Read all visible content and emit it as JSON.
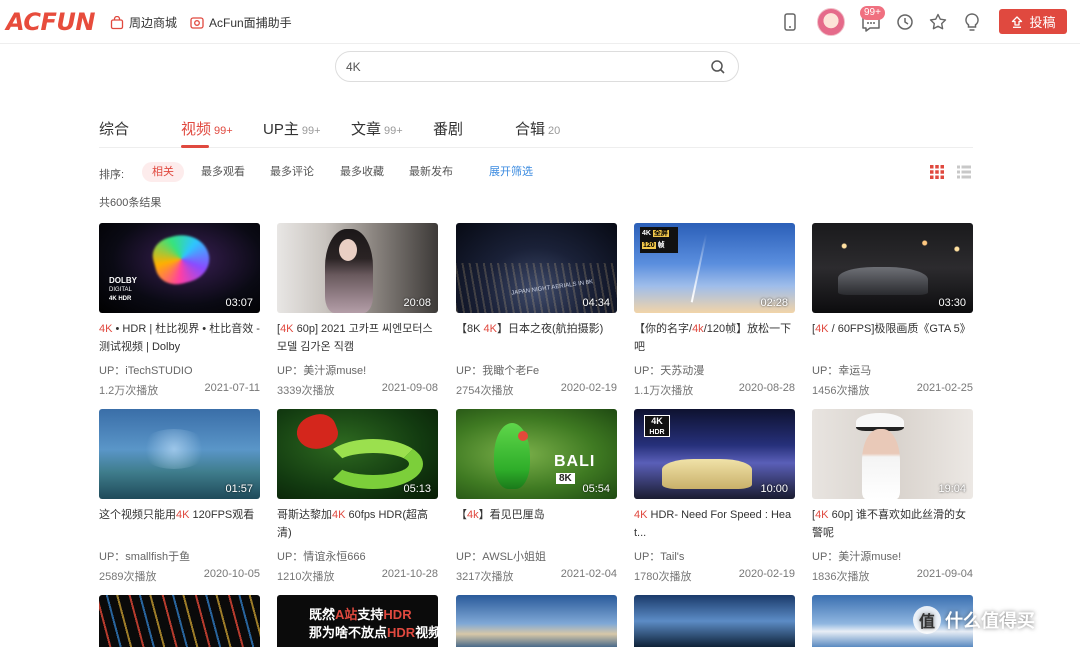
{
  "header": {
    "logo_text": "ACFUN",
    "links": [
      {
        "label": "周边商城",
        "icon": "shop-icon"
      },
      {
        "label": "AcFun面捕助手",
        "icon": "camera-icon"
      }
    ],
    "badge": "99+",
    "upload_label": "投稿"
  },
  "search": {
    "value": "4K"
  },
  "tabs": [
    {
      "label": "综合",
      "count": ""
    },
    {
      "label": "视频",
      "count": "99+"
    },
    {
      "label": "UP主",
      "count": "99+"
    },
    {
      "label": "文章",
      "count": "99+"
    },
    {
      "label": "番剧",
      "count": ""
    },
    {
      "label": "合辑",
      "count": "20"
    }
  ],
  "sort": {
    "label": "排序:",
    "options": [
      "相关",
      "最多观看",
      "最多评论",
      "最多收藏",
      "最新发布"
    ],
    "expand": "展开筛选"
  },
  "result_count": "共600条结果",
  "videos": [
    {
      "hl": "4K",
      "title": " • HDR | 杜比视界 • 杜比音效 - 测试视频 | Dolby",
      "duration": "03:07",
      "up": "UP：iTechSTUDIO",
      "views": "1.2万次播放",
      "date": "2021-07-11"
    },
    {
      "pre": "[",
      "hl": "4K",
      "title": " 60p] 2021 고카프 씨엔모터스 모델 김가온 직캠",
      "duration": "20:08",
      "up": "UP：美汁源muse!",
      "views": "3339次播放",
      "date": "2021-09-08"
    },
    {
      "pre": "【8K ",
      "hl": "4K",
      "title": "】日本之夜(航拍摄影)",
      "duration": "04:34",
      "up": "UP：我瞰个老Fe",
      "views": "2754次播放",
      "date": "2020-02-19"
    },
    {
      "pre": "【你的名字/",
      "hl": "4k",
      "title": "/120帧】放松一下吧",
      "duration": "02:28",
      "up": "UP：天苏动漫",
      "views": "1.1万次播放",
      "date": "2020-08-28"
    },
    {
      "pre": "[",
      "hl": "4K",
      "title": " / 60FPS]极限画质《GTA 5》",
      "duration": "03:30",
      "up": "UP：幸运马",
      "views": "1456次播放",
      "date": "2021-02-25"
    },
    {
      "pre": "这个视频只能用",
      "hl": "4K",
      "title": " 120FPS观看",
      "duration": "01:57",
      "up": "UP：smallfish于鱼",
      "views": "2589次播放",
      "date": "2020-10-05"
    },
    {
      "pre": "哥斯达黎加",
      "hl": "4K",
      "title": " 60fps HDR(超高清)",
      "duration": "05:13",
      "up": "UP：情谊永恒666",
      "views": "1210次播放",
      "date": "2021-10-28"
    },
    {
      "pre": "【",
      "hl": "4k",
      "title": "】看见巴厘岛",
      "duration": "05:54",
      "up": "UP：AWSL小姐姐",
      "views": "3217次播放",
      "date": "2021-02-04"
    },
    {
      "pre": "",
      "hl": "4K",
      "title": " HDR- Need For Speed : Heat...",
      "duration": "10:00",
      "up": "UP：Tail's",
      "views": "1780次播放",
      "date": "2020-02-19"
    },
    {
      "pre": "[",
      "hl": "4K",
      "title": " 60p] 谁不喜欢如此丝滑的女警呢",
      "duration": "19:04",
      "up": "UP：美汁源muse!",
      "views": "1836次播放",
      "date": "2021-09-04"
    },
    {
      "thumb_text": ""
    },
    {
      "thumb_text_a": "既然",
      "thumb_hl": "A站",
      "thumb_text_b": "支持",
      "thumb_hl2": "HDR",
      "thumb_line2": "那为啥不放点",
      "thumb_hl3": "HDR",
      "thumb_line2b": "视频呢?"
    },
    {},
    {},
    {}
  ],
  "thumb_overlays": {
    "dolby": "DOLBY",
    "dolby_sub": "DIGITAL",
    "hdr_4k": "4K HDR",
    "japan": "JAPAN NIGHT AERIALS IN 8K",
    "bali": "BALI",
    "bali_8k": "8K",
    "badge_4k": "4K",
    "badge_full": "全屏",
    "badge_120": "120",
    "badge_fps": "帧",
    "hdr": "HDR"
  },
  "watermark": {
    "badge": "值",
    "text": "什么值得买"
  }
}
